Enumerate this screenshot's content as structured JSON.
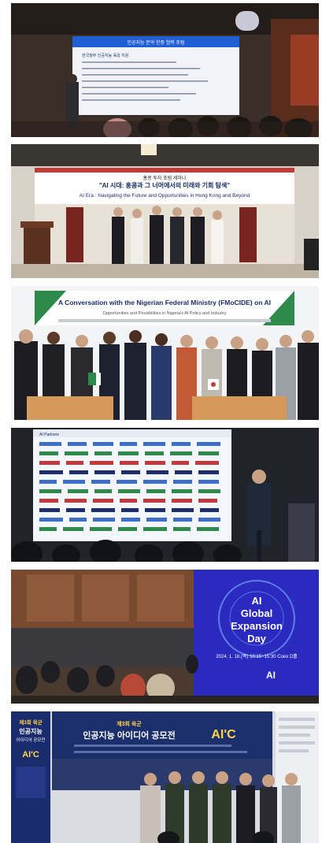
{
  "photos": [
    {
      "id": "photo-1",
      "screen_title": "인공지능 분야 한중 협력 포럼",
      "screen_subtitle": "한국정부 인공지능 육성 지원"
    },
    {
      "id": "photo-2",
      "banner_title_kr": "\"AI 시대: 홍콩과 그 너머에서의 미래와 기회 탐색\"",
      "banner_title_en": "AI Era : Navigating the Future and Opportunities in Hong Kong and Beyond",
      "banner_host_kr": "홍콩 투자 포럼 세미나"
    },
    {
      "id": "photo-3",
      "banner_title": "A Conversation with the Nigerian Federal Ministry (FMoCIDE) on AI",
      "banner_subtitle": "Opportunities and Possibilities in Nigeria's AI Policy and Industry"
    },
    {
      "id": "photo-4",
      "screen_label": "AI Partners"
    },
    {
      "id": "photo-5",
      "screen_title_line1": "AI",
      "screen_title_line2": "Global",
      "screen_title_line3": "Expansion",
      "screen_title_line4": "Day",
      "screen_date": "2024. 1. 18.(목) 10:15~15:30 Coex D홀",
      "screen_brand": "AI"
    },
    {
      "id": "photo-6",
      "banner_small": "제3회 육군",
      "banner_title": "인공지능 아이디어 공모전",
      "banner_logo": "AI'C",
      "standee_line1": "제3회 육군",
      "standee_line2": "인공지능",
      "standee_line3": "아이디어 공모전",
      "standee_logo": "AI'C"
    }
  ],
  "colors": {
    "projector_blue": "#1e5fd6",
    "banner_navy": "#1a2f6b",
    "banner_green": "#2d8a4a",
    "stage_purple": "#3b2bb0"
  }
}
